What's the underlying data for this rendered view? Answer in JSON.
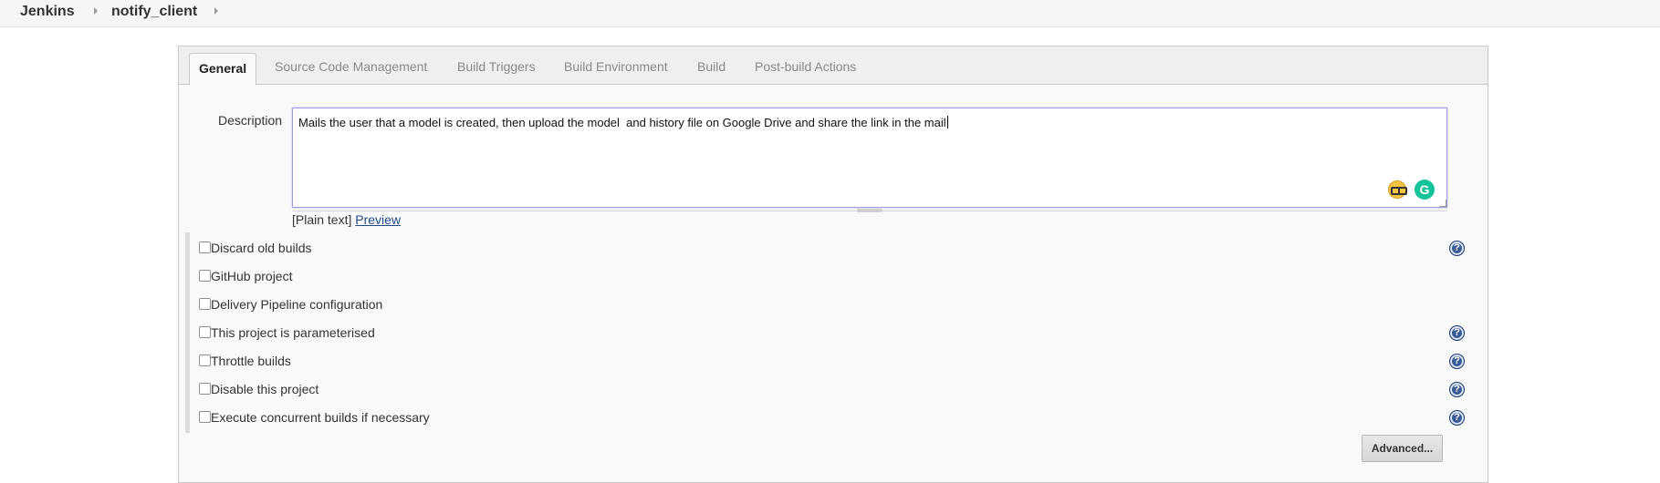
{
  "breadcrumb": {
    "items": [
      "Jenkins",
      "notify_client"
    ]
  },
  "tabs": [
    {
      "label": "General",
      "active": true
    },
    {
      "label": "Source Code Management",
      "active": false
    },
    {
      "label": "Build Triggers",
      "active": false
    },
    {
      "label": "Build Environment",
      "active": false
    },
    {
      "label": "Build",
      "active": false
    },
    {
      "label": "Post-build Actions",
      "active": false
    }
  ],
  "description": {
    "label": "Description",
    "value": "Mails the user that a model is created, then upload the model  and history file on Google Drive and share the link in the mail",
    "format_prefix": "[Plain text]",
    "preview_link": "Preview"
  },
  "options": [
    {
      "label": "Discard old builds",
      "checked": false,
      "has_help": true
    },
    {
      "label": "GitHub project",
      "checked": false,
      "has_help": false
    },
    {
      "label": "Delivery Pipeline configuration",
      "checked": false,
      "has_help": false
    },
    {
      "label": "This project is parameterised",
      "checked": false,
      "has_help": true
    },
    {
      "label": "Throttle builds",
      "checked": false,
      "has_help": true
    },
    {
      "label": "Disable this project",
      "checked": false,
      "has_help": true
    },
    {
      "label": "Execute concurrent builds if necessary",
      "checked": false,
      "has_help": true
    }
  ],
  "help_icon_glyph": "?",
  "grammarly_glyph": "G",
  "advanced_button": "Advanced...",
  "icons": {
    "breadcrumb_separator": "chevron-right-icon",
    "help": "question-mark-icon",
    "nerd_extension": "nerd-face-icon",
    "grammarly": "grammarly-icon"
  },
  "colors": {
    "link": "#204a87",
    "help_icon": "#3a5c96",
    "grammarly": "#15c39a",
    "textarea_focus_border": "#9e9ed8"
  }
}
